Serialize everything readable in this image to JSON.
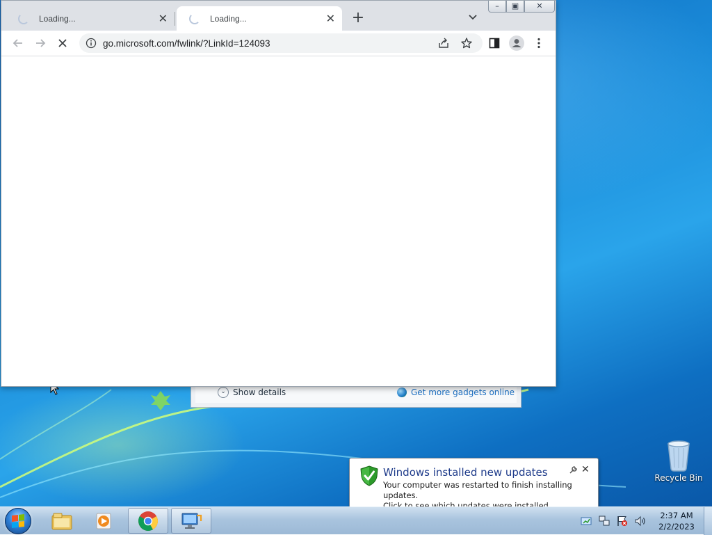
{
  "browser": {
    "tabs": [
      {
        "title": "Loading...",
        "active": false
      },
      {
        "title": "Loading...",
        "active": true
      }
    ],
    "url": "go.microsoft.com/fwlink/?LinkId=124093"
  },
  "gadgets_bar": {
    "show_details": "Show details",
    "get_more": "Get more gadgets online"
  },
  "desktop_icons": [
    {
      "label": "Recycle Bin",
      "icon": "recycle-bin-icon"
    }
  ],
  "notification": {
    "title": "Windows installed new updates",
    "line1": "Your computer was restarted to finish installing updates.",
    "line2": "Click to see which updates were installed."
  },
  "taskbar": {
    "pinned": [
      {
        "name": "windows-explorer",
        "icon": "folder-icon",
        "open": false
      },
      {
        "name": "media-player",
        "icon": "media-player-icon",
        "open": false
      },
      {
        "name": "chrome",
        "icon": "chrome-icon",
        "open": true
      },
      {
        "name": "remote-desktop",
        "icon": "remote-desktop-icon",
        "open": true
      }
    ],
    "clock": {
      "time": "2:37 AM",
      "date": "2/2/2023"
    }
  },
  "colors": {
    "tabstrip": "#dee1e6",
    "link": "#1a6ec2",
    "balloon_title": "#1e3b8a"
  }
}
